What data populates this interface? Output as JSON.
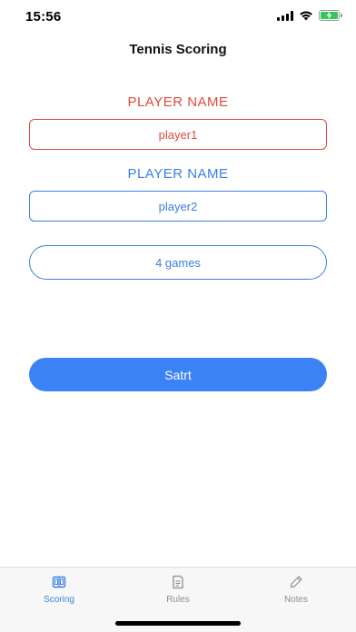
{
  "status_bar": {
    "time": "15:56",
    "icons": [
      "cellular-signal-icon",
      "wifi-icon",
      "battery-charging-icon"
    ]
  },
  "nav": {
    "title": "Tennis Scoring"
  },
  "player1": {
    "label": "PLAYER NAME",
    "value": "player1",
    "color": "#e0493d"
  },
  "player2": {
    "label": "PLAYER NAME",
    "value": "player2",
    "color": "#3a7fe0"
  },
  "games": {
    "value": "4 games"
  },
  "start_button": {
    "label": "Satrt",
    "color": "#3b82f6"
  },
  "tab_bar": {
    "tabs": [
      {
        "label": "Scoring",
        "icon": "scoreboard-icon",
        "active": true
      },
      {
        "label": "Rules",
        "icon": "document-icon",
        "active": false
      },
      {
        "label": "Notes",
        "icon": "pencil-icon",
        "active": false
      }
    ]
  }
}
